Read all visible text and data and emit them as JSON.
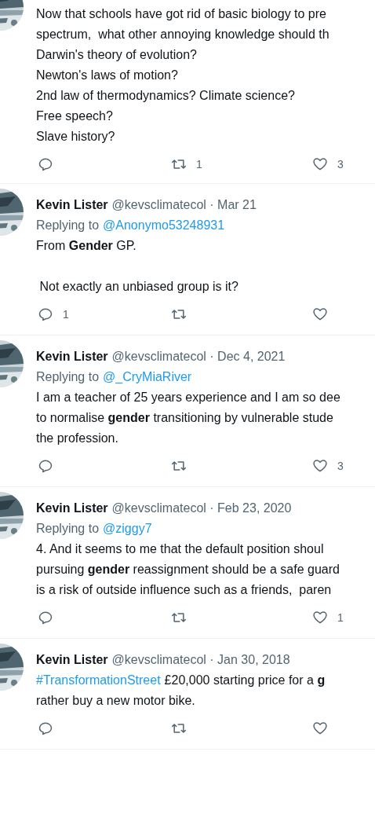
{
  "tweets": [
    {
      "lines": [
        {
          "kind": "text",
          "text": "Now that schools have got rid of basic biology to pre"
        },
        {
          "kind": "text",
          "text": "spectrum,  what other annoying knowledge should th"
        },
        {
          "kind": "text",
          "text": "Darwin's theory of evolution?"
        },
        {
          "kind": "text",
          "text": "Newton's laws of motion?"
        },
        {
          "kind": "text",
          "text": "2nd law of thermodynamics? Climate science?"
        },
        {
          "kind": "text",
          "text": "Free speech?"
        },
        {
          "kind": "text",
          "text": "Slave history?"
        }
      ],
      "retweet_count": "1",
      "like_count": "3"
    },
    {
      "name": "Kevin Lister",
      "meta": "@kevsclimatecol · Mar 21",
      "replying": {
        "prefix": "Replying to",
        "handle": "@Anonymo53248931"
      },
      "lines": [
        {
          "kind": "text",
          "text": "From **Gender** GP."
        },
        {
          "kind": "gap"
        },
        {
          "kind": "text",
          "text": " Not exactly an unbiased group is it?"
        }
      ],
      "reply_count": "1"
    },
    {
      "name": "Kevin Lister",
      "meta": "@kevsclimatecol · Dec 4, 2021",
      "replying": {
        "prefix": "Replying to",
        "handle": "@_CryMiaRiver"
      },
      "lines": [
        {
          "kind": "text",
          "text": "I am a teacher of 25 years experience and I am so dee"
        },
        {
          "kind": "text",
          "text": "to normalise **gender** transitioning by vulnerable stude"
        },
        {
          "kind": "text",
          "text": "the profession."
        }
      ],
      "like_count": "3"
    },
    {
      "name": "Kevin Lister",
      "meta": "@kevsclimatecol · Feb 23, 2020",
      "replying": {
        "prefix": "Replying to",
        "handle": "@ziggy7"
      },
      "lines": [
        {
          "kind": "text",
          "text": "4. And it seems to me that the default position shoul"
        },
        {
          "kind": "text",
          "text": "pursuing **gender** reassignment should be a safe guard"
        },
        {
          "kind": "text",
          "text": "is a risk of outside influence such as a friends,  paren"
        }
      ],
      "like_count": "1"
    },
    {
      "name": "Kevin Lister",
      "meta": "@kevsclimatecol · Jan 30, 2018",
      "lines": [
        {
          "kind": "hashtag",
          "hashtag": "#TransformationStreet",
          "text": "£20,000 starting price for a **g**"
        },
        {
          "kind": "text",
          "text": "rather buy a new motor bike."
        }
      ]
    }
  ]
}
